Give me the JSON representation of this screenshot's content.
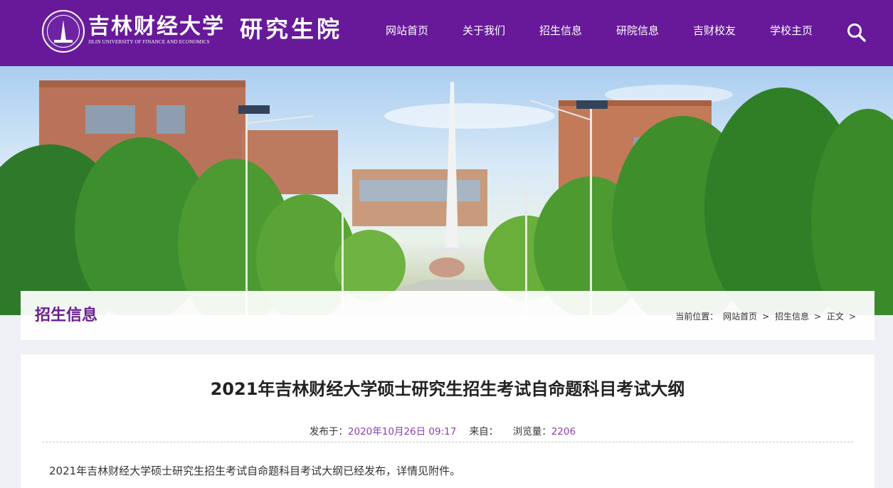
{
  "header": {
    "logo_name": "吉林财经大学",
    "logo_en": "JILIN UNIVERSITY OF FINANCE AND ECONOMICS",
    "site_name": "研究生院",
    "nav": [
      "网站首页",
      "关于我们",
      "招生信息",
      "研院信息",
      "吉财校友",
      "学校主页"
    ],
    "search_icon": "search-icon",
    "color": "#67199a"
  },
  "section": {
    "title": "招生信息",
    "breadcrumb_prefix": "当前位置：",
    "breadcrumb": [
      "网站首页",
      "招生信息",
      "正文"
    ],
    "separator": ">"
  },
  "article": {
    "title": "2021年吉林财经大学硕士研究生招生考试自命题科目考试大纲",
    "published_label": "发布于：",
    "published_value": "2020年10月26日 09:17",
    "source_label": "来自：",
    "views_label": "浏览量：",
    "views_value": "2206",
    "body": "2021年吉林财经大学硕士研究生招生考试自命题科目考试大纲已经发布，详情见附件。",
    "accent_color": "#8b3fb0"
  }
}
